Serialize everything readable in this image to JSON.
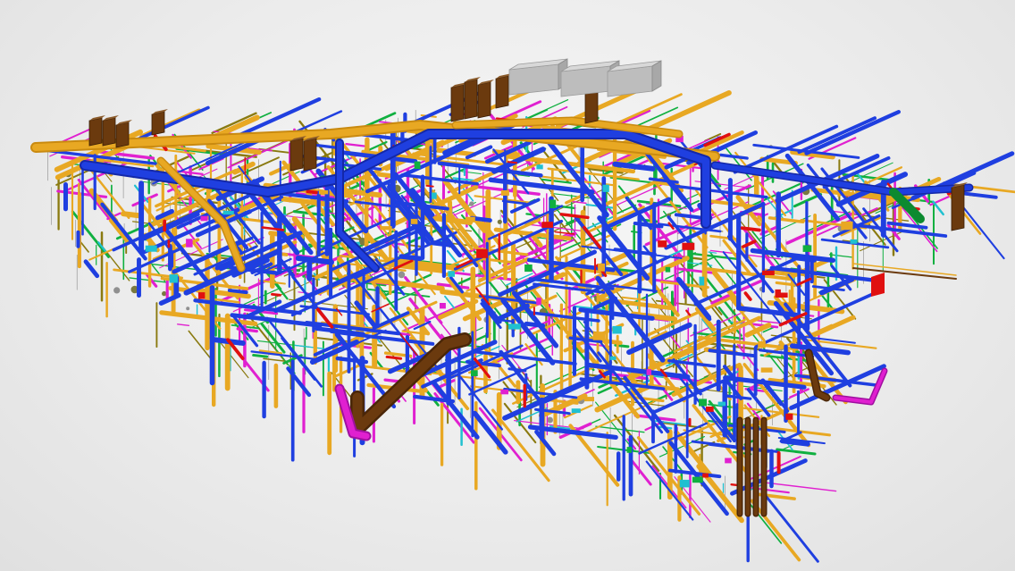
{
  "viewer": {
    "background": "#e9e9e9"
  },
  "colors": {
    "duct_supply": "#1f3fe0",
    "duct_return": "#e8a823",
    "pipe_magenta": "#e020d0",
    "pipe_green": "#10b040",
    "pipe_red": "#e01010",
    "riser_brown": "#6b3a0e",
    "equipment_grey": "#c8c8c8",
    "pipe_cyan": "#20c0d0",
    "pipe_olive": "#8a7a10"
  },
  "model": {
    "layers": [
      "duct_supply",
      "duct_return",
      "pipe_magenta",
      "pipe_green",
      "pipe_red",
      "riser_brown",
      "pipe_cyan",
      "pipe_olive"
    ],
    "equipment_units": 3,
    "risers": 12
  }
}
